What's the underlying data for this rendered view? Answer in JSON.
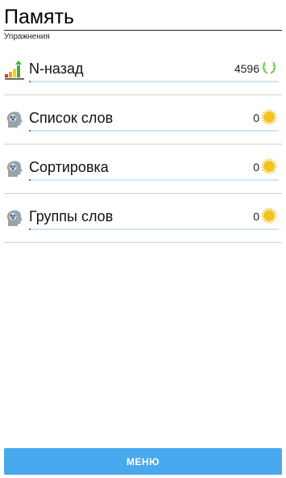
{
  "header": {
    "title": "Память",
    "subtitle": "Упражнения"
  },
  "exercises": [
    {
      "label": "N-назад",
      "value": "4596",
      "icon": "bar-chart-up-icon",
      "badge": "laurel-wreath-icon"
    },
    {
      "label": "Список слов",
      "value": "0",
      "icon": "brain-head-icon",
      "badge": "sun-coin-icon"
    },
    {
      "label": "Сортировка",
      "value": "0",
      "icon": "brain-head-icon",
      "badge": "sun-coin-icon"
    },
    {
      "label": "Группы слов",
      "value": "0",
      "icon": "brain-head-icon",
      "badge": "sun-coin-icon"
    }
  ],
  "footer": {
    "menu_label": "МЕНЮ"
  },
  "colors": {
    "accent": "#49a9ef",
    "underline": "#2b88d8",
    "coin": "#f6c21c",
    "laurel": "#7ec85a"
  }
}
